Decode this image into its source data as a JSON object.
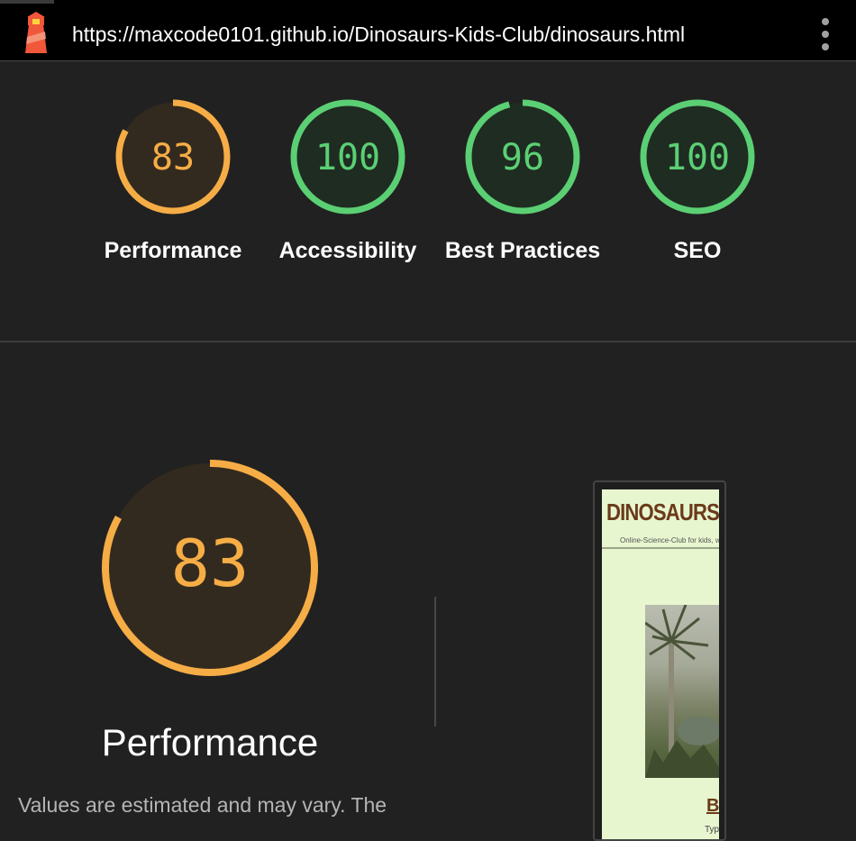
{
  "address_bar": {
    "url": "https://maxcode0101.github.io/Dinosaurs-Kids-Club/dinosaurs.html",
    "logo_icon": "lighthouse-icon",
    "menu_icon": "more-vertical-icon"
  },
  "scores": [
    {
      "value": "83",
      "label": "Performance",
      "score": 0.83,
      "color": "#f6ad46"
    },
    {
      "value": "100",
      "label": "Accessibility",
      "score": 1.0,
      "color": "#5bcf74"
    },
    {
      "value": "96",
      "label": "Best Practices",
      "score": 0.96,
      "color": "#5bcf74"
    },
    {
      "value": "100",
      "label": "SEO",
      "score": 1.0,
      "color": "#5bcf74"
    }
  ],
  "performance_section": {
    "score": "83",
    "score_fraction": 0.83,
    "color": "#f6ad46",
    "title": "Performance",
    "note": "Values are estimated and may vary. The"
  },
  "screenshot_preview": {
    "title": "DINOSAURS",
    "subtitle": "Online-Science-Club for kids, who",
    "heading_fragment": "B",
    "small_text": "Typ"
  }
}
